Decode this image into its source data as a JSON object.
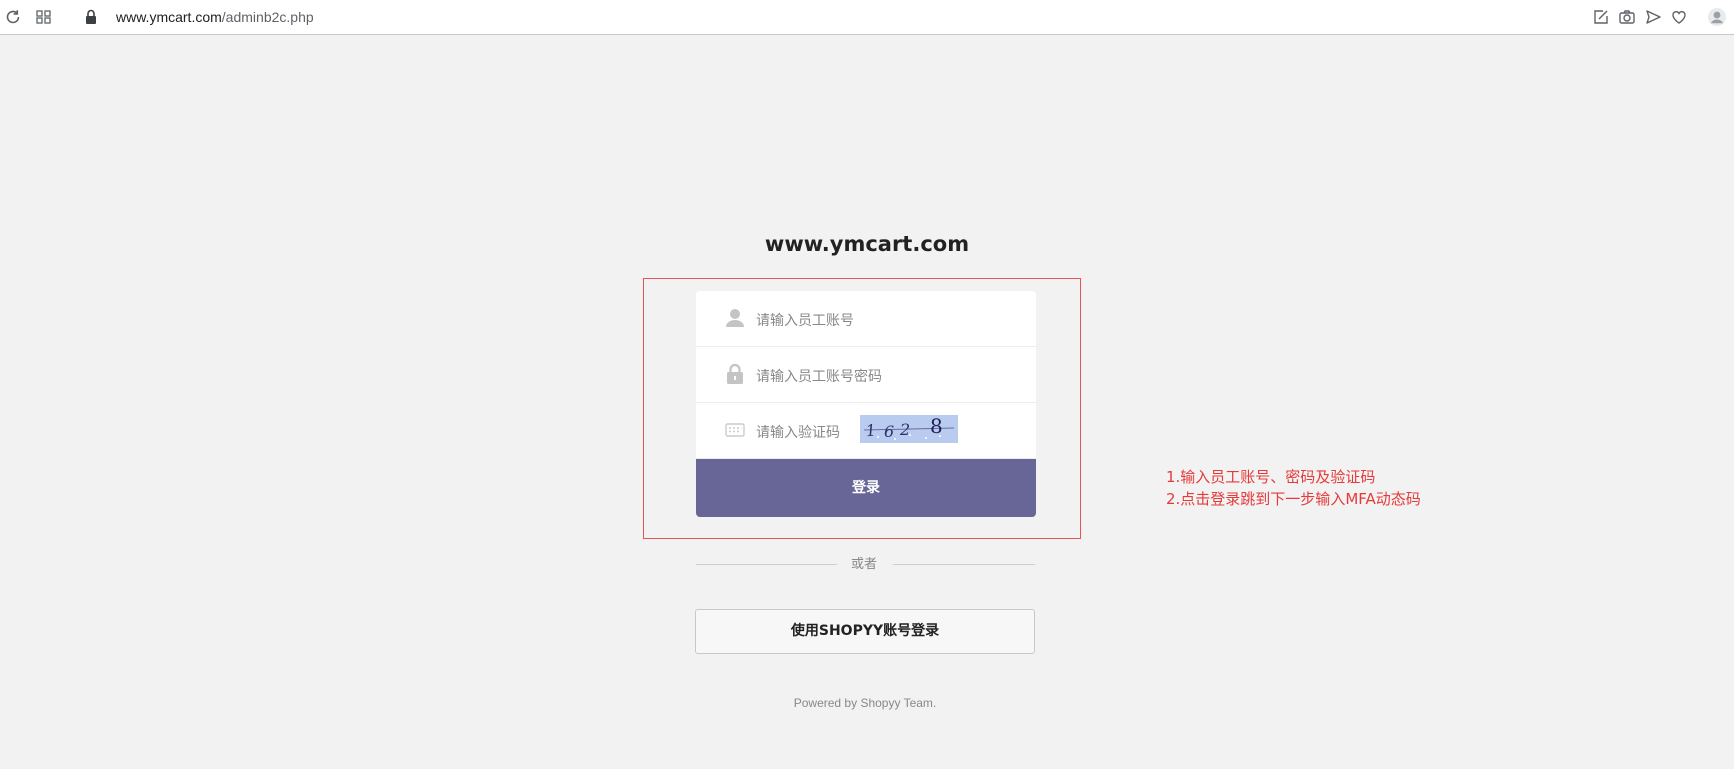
{
  "browser": {
    "url_host": "www.ymcart.com",
    "url_path": "/adminb2c.php",
    "icons": [
      "reload-icon",
      "apps-grid-icon",
      "lock-icon",
      "share-edit-icon",
      "camera-icon",
      "send-icon",
      "heart-icon",
      "profile-icon"
    ]
  },
  "login": {
    "site_title": "www.ymcart.com",
    "username_placeholder": "请输入员工账号",
    "password_placeholder": "请输入员工账号密码",
    "captcha_placeholder": "请输入验证码",
    "captcha_text": "1628",
    "login_button": "登录",
    "or_text": "或者",
    "shopyy_button": "使用SHOPYY账号登录",
    "footer": "Powered by Shopyy Team."
  },
  "annotation": {
    "line1": "1.输入员工账号、密码及验证码",
    "line2": "2.点击登录跳到下一步输入MFA动态码",
    "color": "#e53a3a"
  },
  "colors": {
    "page_bg": "#f2f2f2",
    "login_button_bg": "#676697",
    "captcha_bg": "#b9ccef",
    "annotation_border": "#e25555"
  }
}
